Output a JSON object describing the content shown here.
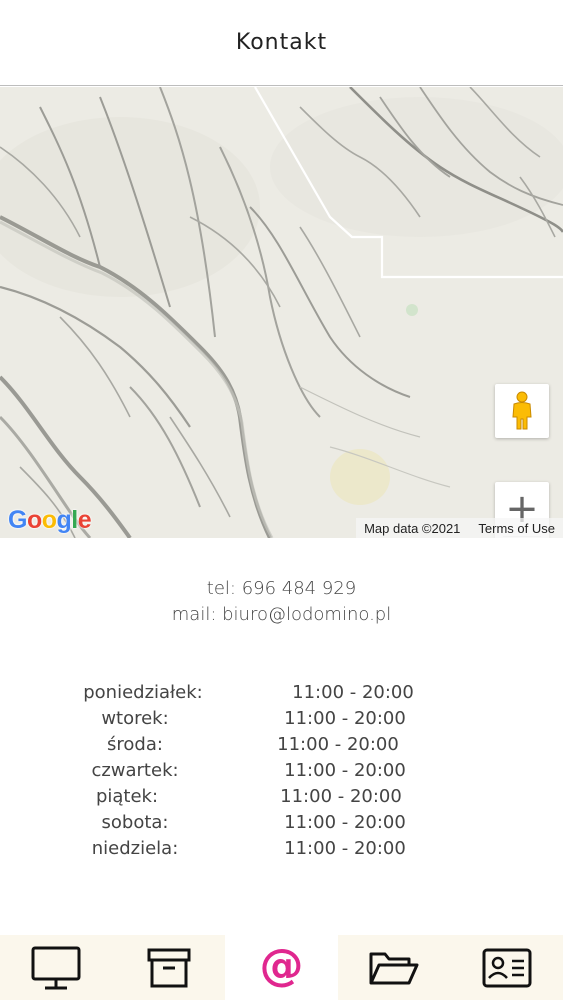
{
  "header": {
    "title": "Kontakt"
  },
  "map": {
    "logo_letters": [
      "G",
      "o",
      "o",
      "g",
      "l",
      "e"
    ],
    "map_data": "Map data ©2021",
    "terms": "Terms of Use",
    "zoom_in_label": "+",
    "zoom_out_label": "−"
  },
  "contact": {
    "phone": "tel: 696 484 929",
    "email": "mail: biuro@lodomino.pl"
  },
  "hours": [
    {
      "day": "poniedziałek:",
      "time": "11:00 - 20:00"
    },
    {
      "day": "wtorek:",
      "time": "11:00 - 20:00"
    },
    {
      "day": "środa:",
      "time": "11:00 - 20:00"
    },
    {
      "day": "czwartek:",
      "time": "11:00 - 20:00"
    },
    {
      "day": "piątek:",
      "time": "11:00 - 20:00"
    },
    {
      "day": "sobota:",
      "time": "11:00 - 20:00"
    },
    {
      "day": "niedziela:",
      "time": "11:00 - 20:00"
    }
  ],
  "nav": {
    "items": [
      {
        "icon": "monitor-icon"
      },
      {
        "icon": "archive-box-icon"
      },
      {
        "icon": "at-sign-icon",
        "glyph": "@",
        "active": true
      },
      {
        "icon": "folder-open-icon"
      },
      {
        "icon": "contact-card-icon"
      }
    ],
    "active_color": "#e0278f"
  }
}
